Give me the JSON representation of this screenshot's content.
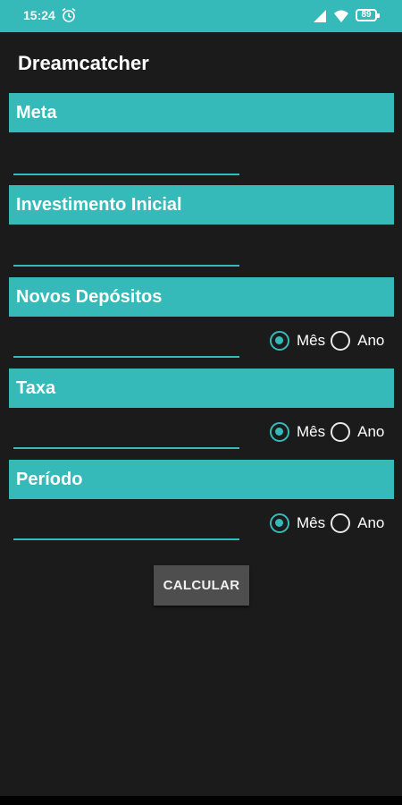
{
  "status_bar": {
    "time": "15:24",
    "battery": "89",
    "icons": [
      "alarm-icon",
      "signal-icon",
      "wifi-icon",
      "battery-icon"
    ]
  },
  "app": {
    "title": "Dreamcatcher"
  },
  "colors": {
    "accent": "#35b9b9",
    "background": "#1b1b1b",
    "button": "#4e4e4e"
  },
  "fields": [
    {
      "label": "Meta",
      "value": ""
    },
    {
      "label": "Investimento Inicial",
      "value": ""
    },
    {
      "label": "Novos Depósitos",
      "value": "",
      "period": {
        "options": [
          "Mês",
          "Ano"
        ],
        "selected": "Mês"
      }
    },
    {
      "label": "Taxa",
      "value": "",
      "period": {
        "options": [
          "Mês",
          "Ano"
        ],
        "selected": "Mês"
      }
    },
    {
      "label": "Período",
      "value": "",
      "period": {
        "options": [
          "Mês",
          "Ano"
        ],
        "selected": "Mês"
      }
    }
  ],
  "calculate_button": "CALCULAR"
}
